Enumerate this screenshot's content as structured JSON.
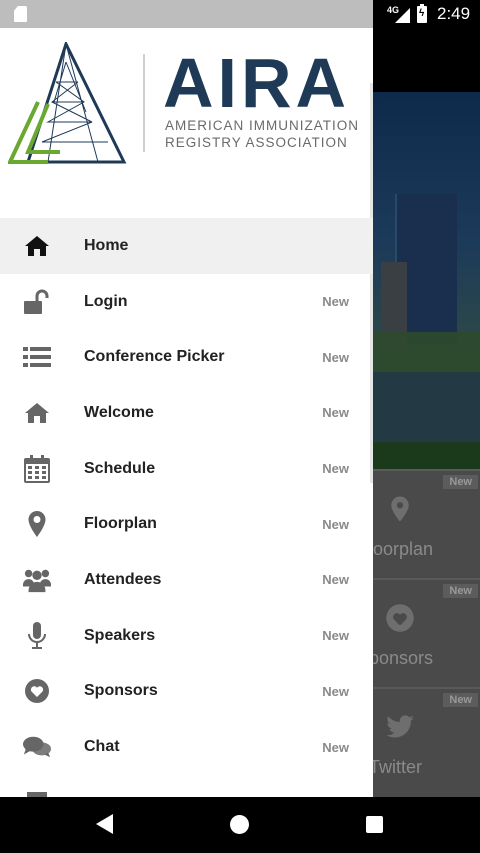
{
  "status_bar": {
    "network": "4G",
    "time": "2:49"
  },
  "logo": {
    "acronym": "AIRA",
    "line1": "AMERICAN IMMUNIZATION",
    "line2": "REGISTRY ASSOCIATION",
    "colors": {
      "navy": "#1f3a57",
      "green": "#6aa832"
    }
  },
  "menu": [
    {
      "label": "Home",
      "icon": "home-icon",
      "badge": "",
      "active": true
    },
    {
      "label": "Login",
      "icon": "unlock-icon",
      "badge": "New"
    },
    {
      "label": "Conference Picker",
      "icon": "list-icon",
      "badge": "New"
    },
    {
      "label": "Welcome",
      "icon": "home-icon",
      "badge": "New"
    },
    {
      "label": "Schedule",
      "icon": "calendar-icon",
      "badge": "New"
    },
    {
      "label": "Floorplan",
      "icon": "map-pin-icon",
      "badge": "New"
    },
    {
      "label": "Attendees",
      "icon": "people-icon",
      "badge": "New"
    },
    {
      "label": "Speakers",
      "icon": "microphone-icon",
      "badge": "New"
    },
    {
      "label": "Sponsors",
      "icon": "heart-icon",
      "badge": "New"
    },
    {
      "label": "Chat",
      "icon": "chat-icon",
      "badge": "New"
    }
  ],
  "background_tiles": [
    {
      "label": "loorplan",
      "badge": "New",
      "icon": "map-pin-icon"
    },
    {
      "label": "ponsors",
      "badge": "New",
      "icon": "heart-icon"
    },
    {
      "label": "Twitter",
      "badge": "New",
      "icon": "twitter-icon"
    }
  ]
}
